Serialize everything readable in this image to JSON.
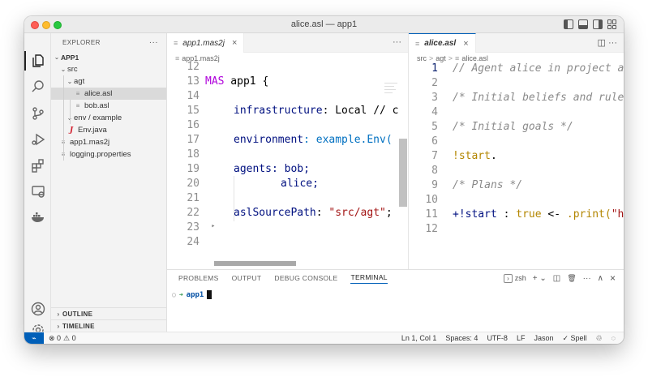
{
  "window": {
    "title": "alice.asl — app1"
  },
  "explorer": {
    "header": "EXPLORER",
    "more": "···",
    "root": "APP1",
    "items": [
      {
        "label": "src",
        "chevron": "⌄"
      },
      {
        "label": "agt",
        "chevron": "⌄"
      },
      {
        "label": "alice.asl",
        "icon": "≡",
        "selected": true
      },
      {
        "label": "bob.asl",
        "icon": "≡"
      },
      {
        "label": "env / example",
        "chevron": "⌄"
      },
      {
        "label": "Env.java",
        "icon": "J"
      },
      {
        "label": "app1.mas2j",
        "icon": "≡"
      },
      {
        "label": "logging.properties",
        "icon": "≡"
      }
    ],
    "outline": "OUTLINE",
    "timeline": "TIMELINE"
  },
  "editor_left": {
    "tab": {
      "icon": "≡",
      "name": "app1.mas2j",
      "close": "×"
    },
    "more": "···",
    "breadcrumb": "app1.mas2j",
    "line_numbers": [
      "12",
      "13",
      "14",
      "15",
      "16",
      "17",
      "18",
      "19",
      "20",
      "21",
      "22",
      "23",
      "24"
    ],
    "lines": {
      "l13a": "MAS",
      "l13b": " app1 {",
      "l15a": "infrastructure",
      "l15b": ": Local // c",
      "l17a": "environment",
      "l17b": ": example.Env(",
      "l19a": "agents",
      "l19b": ": bob;",
      "l20": "alice;",
      "l22a": "aslSourcePath",
      "l22b": ": ",
      "l22c": "\"src/agt\"",
      "l22d": ";",
      "l23": "‣"
    }
  },
  "editor_right": {
    "tab": {
      "icon": "≡",
      "name": "alice.asl",
      "close": "×"
    },
    "actions": "◫  ···",
    "breadcrumb": {
      "a": "src",
      "b": "agt",
      "c": "alice.asl",
      "sep": ">",
      "icon": "≡"
    },
    "line_numbers": [
      "1",
      "2",
      "3",
      "4",
      "5",
      "6",
      "7",
      "8",
      "9",
      "10",
      "11",
      "12"
    ],
    "lines": {
      "l1": "// Agent alice in project app",
      "l3": "/* Initial beliefs and rules",
      "l5": "/* Initial goals */",
      "l7a": "!start",
      "l7b": ".",
      "l9": "/* Plans */",
      "l11a": "+!start",
      "l11b": " : ",
      "l11c": "true",
      "l11d": " <- ",
      "l11e": ".print(",
      "l11f": "\"hel"
    }
  },
  "panel": {
    "tabs": [
      "PROBLEMS",
      "OUTPUT",
      "DEBUG CONSOLE",
      "TERMINAL"
    ],
    "active_tab": "TERMINAL",
    "shell": "zsh",
    "actions": {
      "add": "+ ⌄",
      "split": "◫",
      "trash": "🗑",
      "more": "···",
      "maximize": "∧",
      "close": "×"
    },
    "terminal": {
      "dot": "○",
      "arrow": "➜",
      "dir": "app1"
    }
  },
  "statusbar": {
    "remote": "⌁",
    "errors": "⊗ 0",
    "warnings": "⚠ 0",
    "position": "Ln 1, Col 1",
    "spaces": "Spaces: 4",
    "encoding": "UTF-8",
    "eol": "LF",
    "language": "Jason",
    "spell": "Spell",
    "spell_icon": "✓"
  },
  "colors": {
    "accent": "#005fb8",
    "keyword": "#af00db",
    "property": "#001080",
    "identifier": "#0070c1",
    "string": "#a31515",
    "comment": "#8a8a8a",
    "goal": "#b38600"
  }
}
